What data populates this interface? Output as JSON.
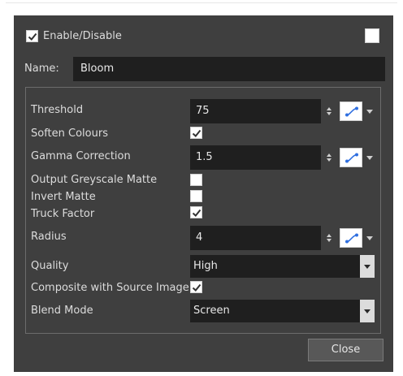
{
  "header": {
    "enable_label": "Enable/Disable",
    "enable_checked": true
  },
  "name": {
    "label": "Name:",
    "value": "Bloom"
  },
  "params": {
    "threshold": {
      "label": "Threshold",
      "value": "75"
    },
    "soften_colours": {
      "label": "Soften Colours",
      "checked": true
    },
    "gamma_correction": {
      "label": "Gamma Correction",
      "value": "1.5"
    },
    "output_greyscale_matte": {
      "label": "Output Greyscale Matte",
      "checked": false
    },
    "invert_matte": {
      "label": "Invert Matte",
      "checked": false
    },
    "truck_factor": {
      "label": "Truck Factor",
      "checked": true
    },
    "radius": {
      "label": "Radius",
      "value": "4"
    },
    "quality": {
      "label": "Quality",
      "value": "High"
    },
    "composite_with_source": {
      "label": "Composite with Source Image",
      "checked": true
    },
    "blend_mode": {
      "label": "Blend Mode",
      "value": "Screen"
    }
  },
  "footer": {
    "close_label": "Close"
  },
  "colors": {
    "dialog_bg": "#3f3f3f",
    "field_bg": "#1f1f1f",
    "function_blue": "#2f6fe0"
  }
}
